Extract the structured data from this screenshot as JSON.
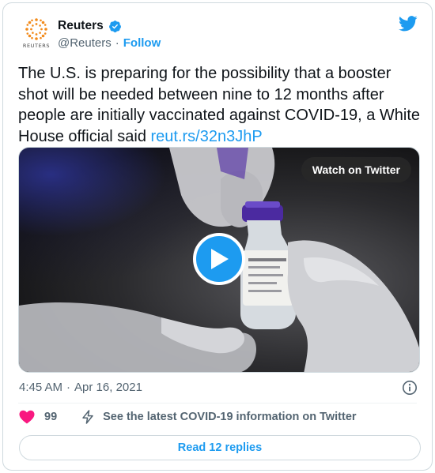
{
  "author": {
    "display_name": "Reuters",
    "handle": "@Reuters",
    "separator": "·",
    "follow_label": "Follow",
    "avatar_word": "REUTERS",
    "verified_icon": "verified-badge-icon"
  },
  "tweet": {
    "text": "The U.S. is preparing for the possibility that a booster shot will be needed between nine to 12 months after people are initially vaccinated against COVID-19, a White House official said ",
    "link_text": "reut.rs/32n3JhP"
  },
  "media": {
    "watch_label": "Watch on Twitter",
    "play_icon": "play-icon"
  },
  "meta": {
    "time": "4:45 AM",
    "separator": "·",
    "date": "Apr 16, 2021"
  },
  "actions": {
    "like_count": "99",
    "covid_label": "See the latest COVID-19 information on Twitter",
    "replies_label": "Read 12 replies"
  },
  "colors": {
    "accent": "#1d9bf0",
    "like": "#f91880",
    "muted_text": "#536471",
    "border": "#cfd9de"
  }
}
